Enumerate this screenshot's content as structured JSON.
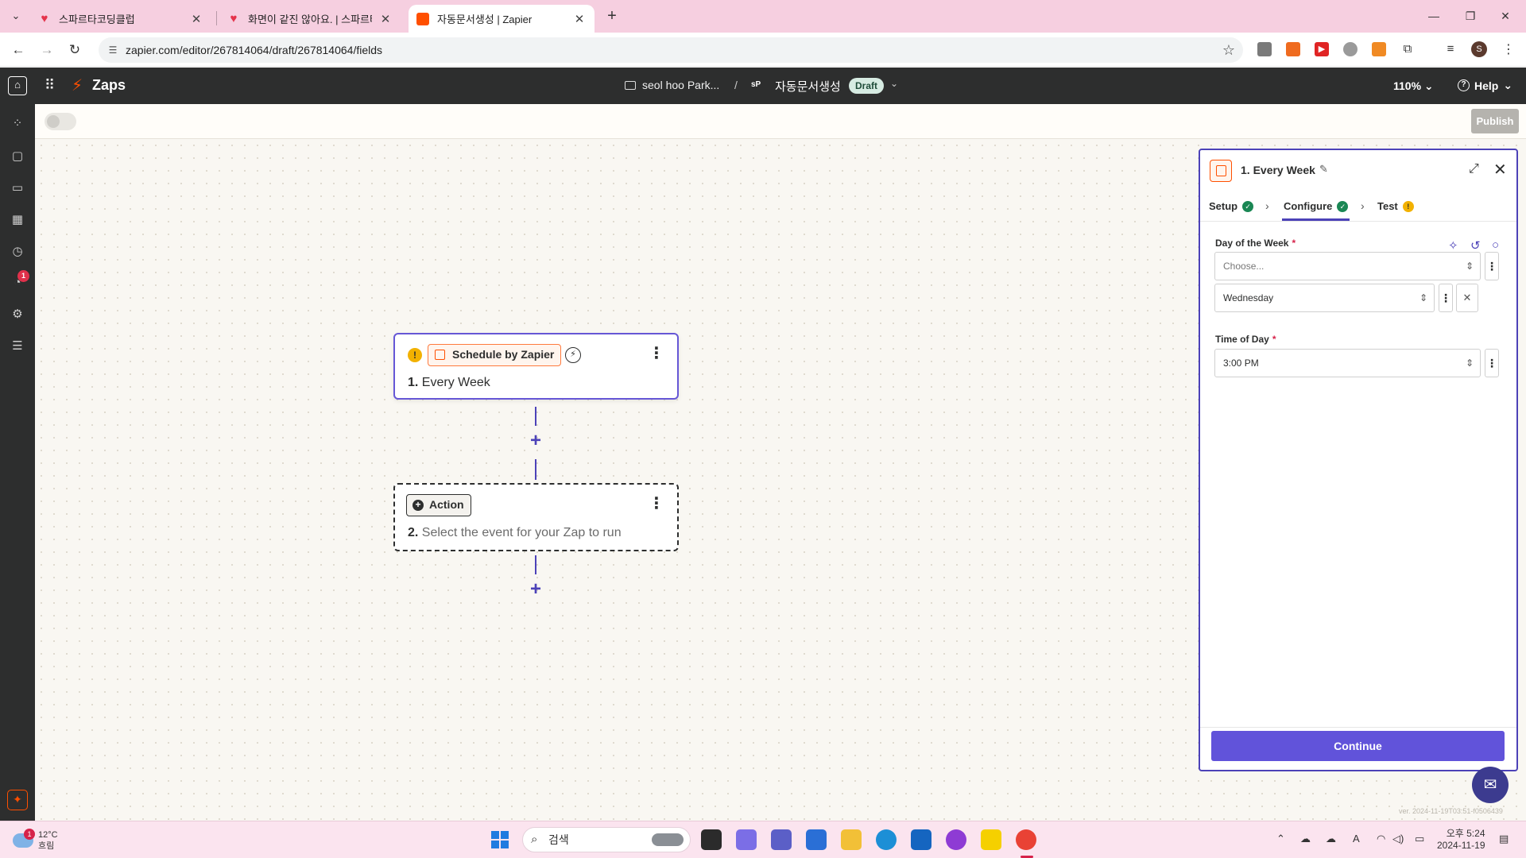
{
  "browser": {
    "tabs": [
      {
        "title": "스파르타코딩클럽",
        "favicon": "heart-icon"
      },
      {
        "title": "화면이 같진 않아요. | 스파르타",
        "favicon": "heart-icon"
      },
      {
        "title": "자동문서생성 | Zapier",
        "favicon": "zapier-icon",
        "active": true
      }
    ],
    "url_domain": "zapier.com",
    "url_path": "/editor/267814064/draft/267814064/fields",
    "profile_initial": "S"
  },
  "app_header": {
    "product": "Zaps",
    "folder": "seol hoo Park...",
    "separator": "/",
    "owner_badge": "sP",
    "zap_name": "자동문서생성",
    "status": "Draft",
    "zoom": "110%",
    "help": "Help"
  },
  "subbar": {
    "publish": "Publish"
  },
  "rail": {
    "notification_count": "1"
  },
  "canvas": {
    "trigger": {
      "warning": "!",
      "app": "Schedule by Zapier",
      "step_number": "1.",
      "step_title": "Every Week"
    },
    "action": {
      "label": "Action",
      "step_number": "2.",
      "step_title": "Select the event for your Zap to run"
    }
  },
  "panel": {
    "title": "1. Every Week",
    "tabs": [
      {
        "label": "Setup",
        "status": "complete"
      },
      {
        "label": "Configure",
        "status": "complete",
        "active": true
      },
      {
        "label": "Test",
        "status": "warning"
      }
    ],
    "fields": {
      "day_of_week": {
        "label": "Day of the Week",
        "required": "*",
        "placeholder": "Choose...",
        "selected": "Wednesday"
      },
      "time_of_day": {
        "label": "Time of Day",
        "required": "*",
        "value": "3:00 PM"
      }
    },
    "continue": "Continue"
  },
  "version": "ver. 2024-11-19T03:51-f0506439",
  "taskbar": {
    "weather_temp": "12°C",
    "weather_desc": "흐림",
    "weather_badge": "1",
    "search": "검색",
    "clock_time": "오후 5:24",
    "clock_date": "2024-11-19"
  }
}
